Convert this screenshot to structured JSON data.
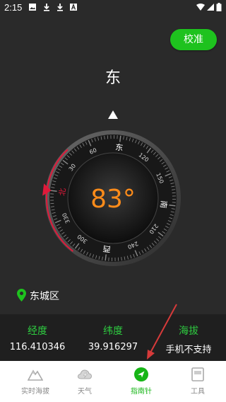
{
  "status_bar": {
    "time": "2:15"
  },
  "calibrate_label": "校准",
  "direction": "东",
  "compass": {
    "degree_text": "83°",
    "heading": 83,
    "cardinals": {
      "east": "东",
      "south": "南",
      "west": "西",
      "north": "北"
    },
    "ticks": [
      "30",
      "60",
      "120",
      "150",
      "210",
      "240",
      "300",
      "330"
    ]
  },
  "location": "东城区",
  "info": {
    "longitude": {
      "label": "经度",
      "value": "116.410346"
    },
    "latitude": {
      "label": "纬度",
      "value": "39.916297"
    },
    "altitude": {
      "label": "海拔",
      "value": "手机不支持"
    }
  },
  "nav": {
    "items": [
      {
        "label": "实时海拔",
        "icon": "mountain-icon"
      },
      {
        "label": "天气",
        "icon": "weather-icon"
      },
      {
        "label": "指南针",
        "icon": "compass-nav-icon"
      },
      {
        "label": "工具",
        "icon": "tools-icon"
      }
    ],
    "active_index": 2
  },
  "colors": {
    "accent": "#1ec21e",
    "label_green": "#2ecc40",
    "north_red": "#e0193a",
    "degree_orange": "#ff8c1a"
  }
}
